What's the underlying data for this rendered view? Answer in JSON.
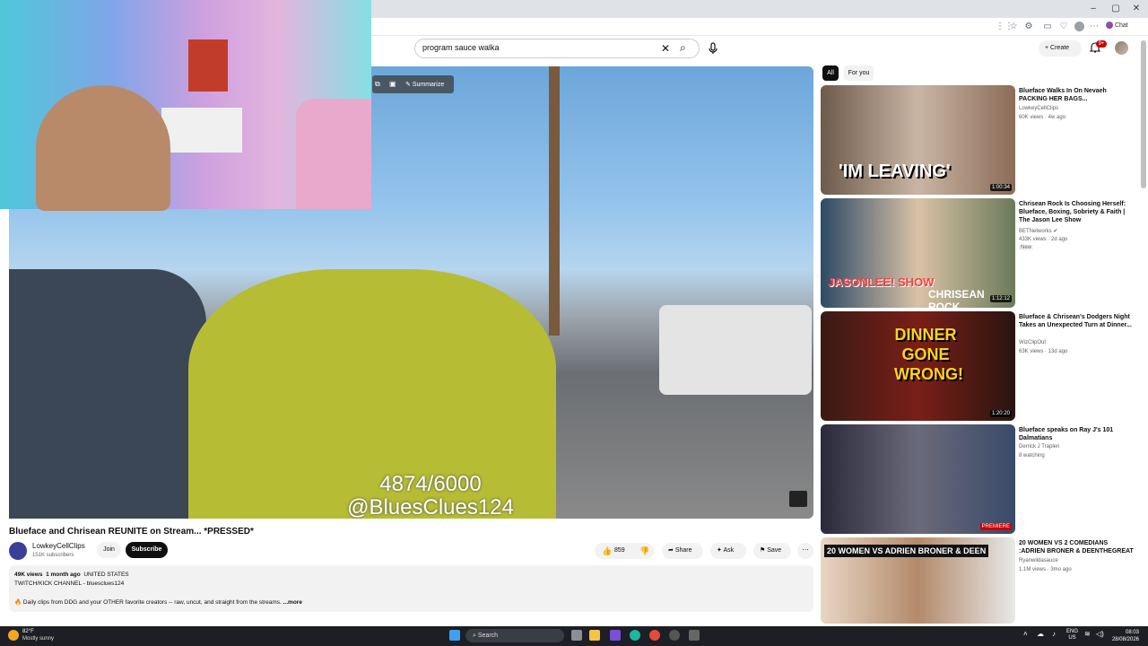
{
  "browser": {
    "window_controls": [
      "–",
      "▢",
      "✕"
    ],
    "chat_label": "Chat"
  },
  "header": {
    "search_value": "program sauce walka",
    "create_label": "Create",
    "notification_count": "9+"
  },
  "video": {
    "summarize_label": "Summarize",
    "overlay_text_1": "4874/6000",
    "overlay_text_2": "@BluesClues124",
    "title": "Blueface and Chrisean REUNITE on Stream... *PRESSED*"
  },
  "channel": {
    "name": "LowkeyCellClips",
    "subscribers": "151K subscribers",
    "join_label": "Join",
    "subscribe_label": "Subscribe"
  },
  "actions": {
    "likes": "859",
    "share_label": "Share",
    "ask_label": "Ask",
    "save_label": "Save"
  },
  "description": {
    "views": "49K views",
    "age": "1 month ago",
    "country": "UNITED STATES",
    "line2": "TWITCH/KICK CHANNEL - bluesclues124",
    "line3": "Daily clips from DDG and your OTHER favorite creators -- raw, uncut, and straight from the streams.",
    "more": "...more",
    "emoji": "🔥"
  },
  "chips": {
    "all": "All",
    "for_you": "For you"
  },
  "recommendations": [
    {
      "title": "Blueface Walks In On Nevaeh PACKING HER BAGS...",
      "channel": "LowkeyCellClips",
      "meta": "60K views · 4w ago",
      "duration": "1:00:34",
      "thumb_text": "'IM LEAVING'"
    },
    {
      "title": "Chrisean Rock Is Choosing Herself: Blueface, Boxing, Sobriety & Faith | The Jason Lee Show",
      "channel": "BETNetworks",
      "meta": "433K views · 2d ago",
      "badge": "New",
      "duration": "1:12:12",
      "thumb_text_1": "JASONLEE! SHOW",
      "thumb_text_2": "CHRISEAN ROCK"
    },
    {
      "title": "Blueface & Chrisean's Dodgers Night Takes an Unexpected Turn at Dinner...",
      "channel": "WizClipOut",
      "meta": "63K views · 13d ago",
      "duration": "1:20:20",
      "thumb_text": "DINNER GONE WRONG!"
    },
    {
      "title": "Blueface speaks on Ray J's 101 Dalmatians",
      "channel": "Derrick J Traplen",
      "meta": "8 watching",
      "duration": "PREMIERE"
    },
    {
      "title": "20 WOMEN VS 2 COMEDIANS :ADRIEN BRONER & DEENTHEGREAT",
      "channel": "Ryanwildasauce",
      "meta": "1.1M views · 3mo ago",
      "thumb_text": "20 WOMEN VS ADRIEN BRONER & DEEN"
    }
  ],
  "taskbar": {
    "temperature": "82°F",
    "weather": "Mostly sunny",
    "search_placeholder": "Search",
    "language": "ENG",
    "region": "US",
    "time": "08:03",
    "date": "28/08/2026"
  }
}
